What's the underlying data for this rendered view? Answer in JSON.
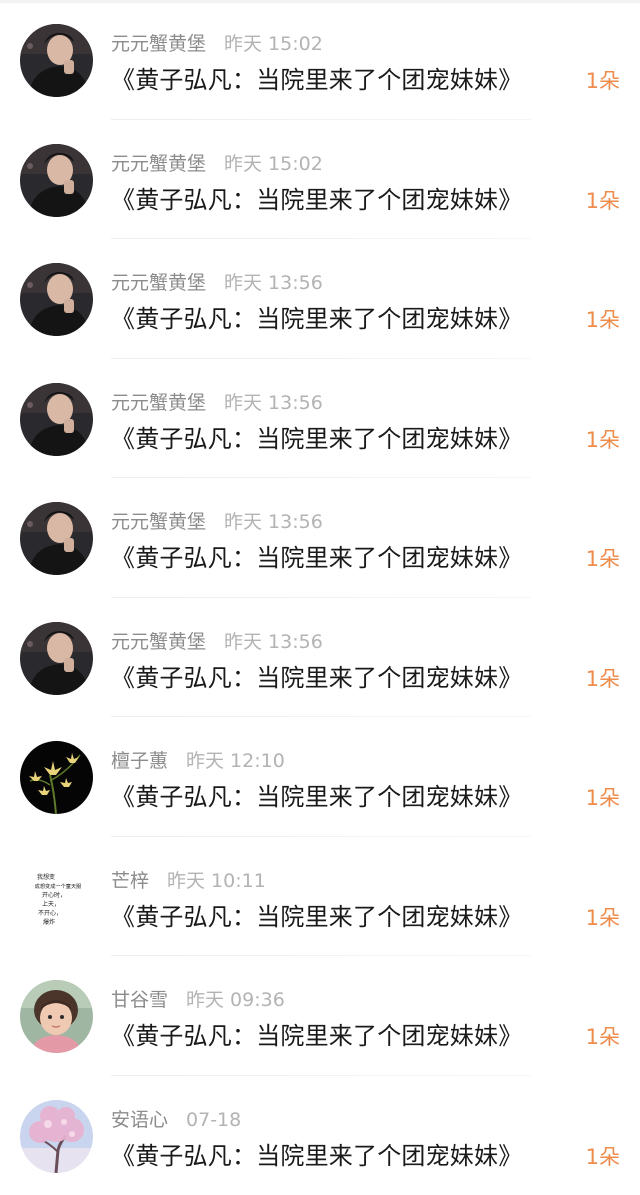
{
  "gift_list": {
    "items": [
      {
        "name": "元元蟹黄堡",
        "time": "昨天 15:02",
        "title": "《黄子弘凡：当院里来了个团宠妹妹》",
        "gift": "1朵",
        "avatar": "portrait-icon"
      },
      {
        "name": "元元蟹黄堡",
        "time": "昨天 15:02",
        "title": "《黄子弘凡：当院里来了个团宠妹妹》",
        "gift": "1朵",
        "avatar": "portrait-icon"
      },
      {
        "name": "元元蟹黄堡",
        "time": "昨天 13:56",
        "title": "《黄子弘凡：当院里来了个团宠妹妹》",
        "gift": "1朵",
        "avatar": "portrait-icon"
      },
      {
        "name": "元元蟹黄堡",
        "time": "昨天 13:56",
        "title": "《黄子弘凡：当院里来了个团宠妹妹》",
        "gift": "1朵",
        "avatar": "portrait-icon"
      },
      {
        "name": "元元蟹黄堡",
        "time": "昨天 13:56",
        "title": "《黄子弘凡：当院里来了个团宠妹妹》",
        "gift": "1朵",
        "avatar": "portrait-icon"
      },
      {
        "name": "元元蟹黄堡",
        "time": "昨天 13:56",
        "title": "《黄子弘凡：当院里来了个团宠妹妹》",
        "gift": "1朵",
        "avatar": "portrait-icon"
      },
      {
        "name": "檀子蕙",
        "time": "昨天 12:10",
        "title": "《黄子弘凡：当院里来了个团宠妹妹》",
        "gift": "1朵",
        "avatar": "orchid-icon"
      },
      {
        "name": "芒梓",
        "time": "昨天 10:11",
        "title": "《黄子弘凡：当院里来了个团宠妹妹》",
        "gift": "1朵",
        "avatar": "text-note-icon",
        "avatar_text": [
          "我想变",
          "成想变成一个童天服",
          "开心时，",
          "上天，",
          "不开心，",
          "爆炸"
        ]
      },
      {
        "name": "甘谷雪",
        "time": "昨天 09:36",
        "title": "《黄子弘凡：当院里来了个团宠妹妹》",
        "gift": "1朵",
        "avatar": "child-photo-icon"
      },
      {
        "name": "安语心",
        "time": "07-18",
        "title": "《黄子弘凡：当院里来了个团宠妹妹》",
        "gift": "1朵",
        "avatar": "blossom-tree-icon"
      }
    ]
  },
  "colors": {
    "name": "#8c8c8c",
    "time": "#b3b3b3",
    "title": "#1a1a1a",
    "gift": "#f08c4b"
  }
}
